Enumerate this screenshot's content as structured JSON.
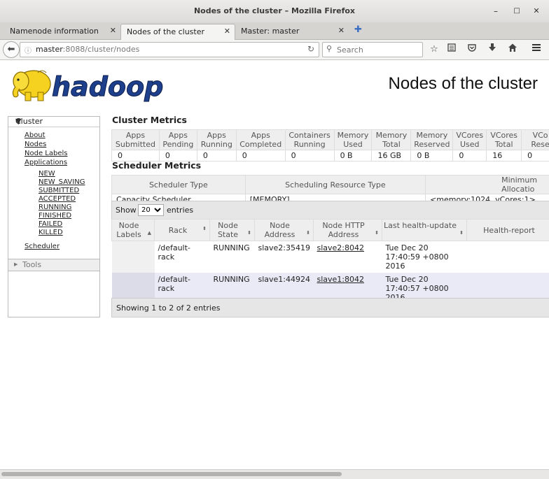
{
  "window": {
    "title": "Nodes of the cluster – Mozilla Firefox",
    "minimize": "–",
    "maximize": "□",
    "close": "✕"
  },
  "tabs": [
    {
      "label": "Namenode information",
      "close": "✕"
    },
    {
      "label": "Nodes of the cluster",
      "close": "✕"
    },
    {
      "label": "Master: master",
      "close": "✕"
    }
  ],
  "new_tab": "✚",
  "nav": {
    "back": "⬅",
    "url_host": "master",
    "url_rest": ":8088/cluster/nodes",
    "reload": "↻",
    "search_placeholder": "Search",
    "toolbar_icons": [
      "star-icon",
      "reading-list-icon",
      "pocket-icon",
      "download-icon",
      "home-icon",
      "menu-icon"
    ]
  },
  "logo_text": "hadoop",
  "page_title": "Nodes of the cluster",
  "sidebar": {
    "cluster_label": "Cluster",
    "links": [
      "About",
      "Nodes",
      "Node Labels",
      "Applications"
    ],
    "app_states": [
      "NEW",
      "NEW_SAVING",
      "SUBMITTED",
      "ACCEPTED",
      "RUNNING",
      "FINISHED",
      "FAILED",
      "KILLED"
    ],
    "scheduler": "Scheduler",
    "tools_label": "Tools"
  },
  "cluster_metrics": {
    "title": "Cluster Metrics",
    "headers": [
      [
        "Apps",
        "Submitted"
      ],
      [
        "Apps",
        "Pending"
      ],
      [
        "Apps",
        "Running"
      ],
      [
        "Apps",
        "Completed"
      ],
      [
        "Containers",
        "Running"
      ],
      [
        "Memory",
        "Used"
      ],
      [
        "Memory",
        "Total"
      ],
      [
        "Memory",
        "Reserved"
      ],
      [
        "VCores",
        "Used"
      ],
      [
        "VCores",
        "Total"
      ],
      [
        "VCo",
        "Rese"
      ]
    ],
    "values": [
      "0",
      "0",
      "0",
      "0",
      "0",
      "0 B",
      "16 GB",
      "0 B",
      "0",
      "16",
      "0"
    ]
  },
  "scheduler_metrics": {
    "title": "Scheduler Metrics",
    "headers": [
      "Scheduler Type",
      "Scheduling Resource Type",
      "Minimum Allocatio"
    ],
    "values": [
      "Capacity Scheduler",
      "[MEMORY]",
      "<memory:1024, vCores:1>"
    ]
  },
  "nodes_table": {
    "show_label": "Show",
    "page_size": "20",
    "entries_label": "entries",
    "headers": [
      [
        "Node",
        "Labels"
      ],
      [
        "Rack"
      ],
      [
        "Node",
        "State"
      ],
      [
        "Node",
        "Address"
      ],
      [
        "Node HTTP",
        "Address"
      ],
      [
        "Last health-update"
      ],
      [
        "Health-report"
      ]
    ],
    "rows": [
      {
        "labels": "",
        "rack": "/default-rack",
        "state": "RUNNING",
        "address": "slave2:35419",
        "http": "slave2:8042",
        "health_update": [
          "Tue Dec 20",
          "17:40:59 +0800",
          "2016"
        ],
        "health_report": ""
      },
      {
        "labels": "",
        "rack": "/default-rack",
        "state": "RUNNING",
        "address": "slave1:44924",
        "http": "slave1:8042",
        "health_update": [
          "Tue Dec 20",
          "17:40:57 +0800",
          "2016"
        ],
        "health_report": ""
      }
    ],
    "footer": "Showing 1 to 2 of 2 entries"
  },
  "colors": {
    "titlebar": "#e3e1de",
    "table_header": "#eeeeee",
    "row_alt": "#eaeaf6",
    "logo_yellow": "#f5d21f",
    "logo_blue": "#1d3f8c"
  }
}
